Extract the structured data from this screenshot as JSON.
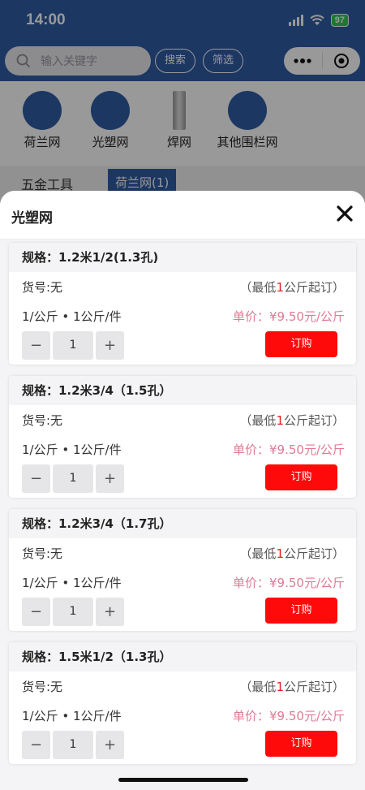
{
  "status_bar": {
    "time": "14:00",
    "battery": "97"
  },
  "header": {
    "search_placeholder": "输入关键字",
    "search_button": "搜索",
    "filter_button": "筛选"
  },
  "categories": [
    {
      "label": "荷兰网",
      "icon": "logo-icon"
    },
    {
      "label": "光塑网",
      "icon": "logo-icon"
    },
    {
      "label": "焊网",
      "icon": "product-bar-icon"
    },
    {
      "label": "其他围栏网",
      "icon": "logo-icon"
    }
  ],
  "tabs": {
    "left": "五金工具",
    "active": "荷兰网(1)"
  },
  "sheet": {
    "title": "光塑网",
    "specs": [
      {
        "spec": "规格：1.2米1/2(1.3孔)",
        "sku": "货号:无",
        "min_prefix": "（最低",
        "min_num": "1",
        "min_suffix": "公斤起订）",
        "unit": "1/公斤 • 1公斤/件",
        "price": "单价：¥9.50元/公斤",
        "qty": "1",
        "minus": "−",
        "plus": "+",
        "order": "订购"
      },
      {
        "spec": "规格：1.2米3/4（1.5孔）",
        "sku": "货号:无",
        "min_prefix": "（最低",
        "min_num": "1",
        "min_suffix": "公斤起订）",
        "unit": "1/公斤 • 1公斤/件",
        "price": "单价：¥9.50元/公斤",
        "qty": "1",
        "minus": "−",
        "plus": "+",
        "order": "订购"
      },
      {
        "spec": "规格：1.2米3/4（1.7孔）",
        "sku": "货号:无",
        "min_prefix": "（最低",
        "min_num": "1",
        "min_suffix": "公斤起订）",
        "unit": "1/公斤 • 1公斤/件",
        "price": "单价：¥9.50元/公斤",
        "qty": "1",
        "minus": "−",
        "plus": "+",
        "order": "订购"
      },
      {
        "spec": "规格：1.5米1/2（1.3孔）",
        "sku": "货号:无",
        "min_prefix": "（最低",
        "min_num": "1",
        "min_suffix": "公斤起订）",
        "unit": "1/公斤 • 1公斤/件",
        "price": "单价：¥9.50元/公斤",
        "qty": "1",
        "minus": "−",
        "plus": "+",
        "order": "订购"
      }
    ]
  },
  "colors": {
    "brand_blue": "#2f5ca4",
    "order_red": "#ff0a0a",
    "price_pink": "#e07a94"
  }
}
